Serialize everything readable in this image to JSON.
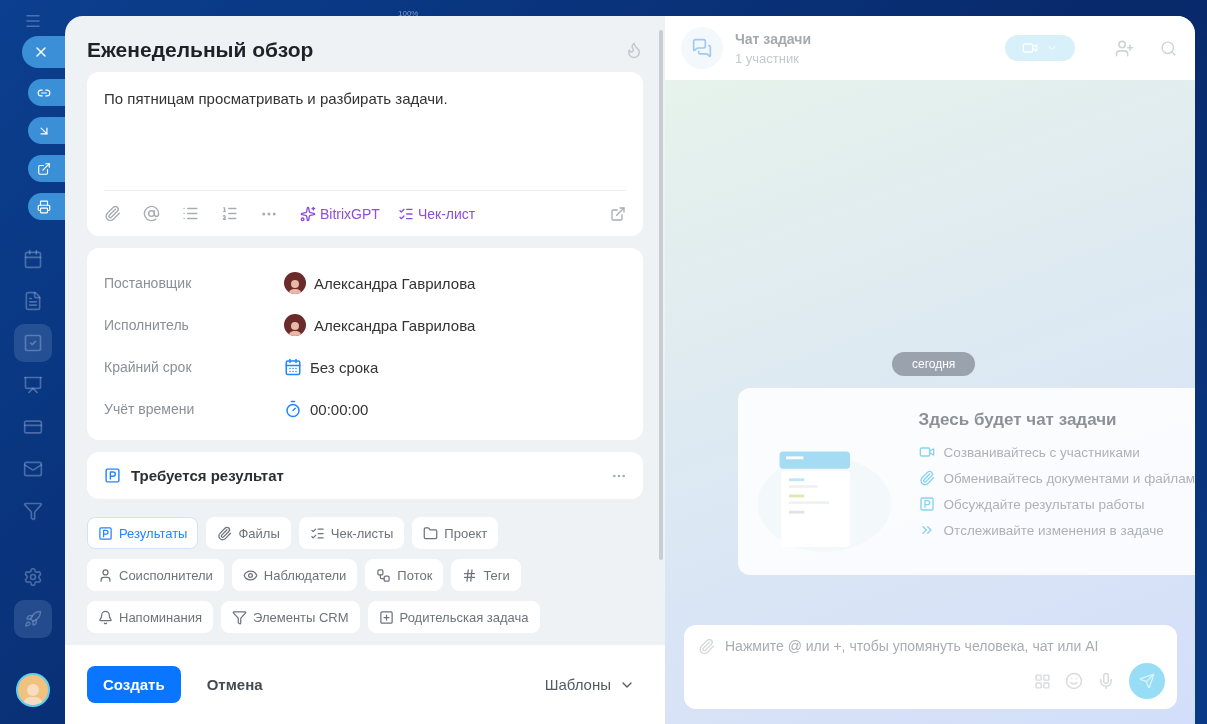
{
  "top_bar": {
    "zoom": "100%"
  },
  "sidebar": {
    "items": [
      {
        "selected": false
      },
      {
        "selected": false
      },
      {
        "selected": true
      },
      {
        "selected": false
      },
      {
        "selected": false
      },
      {
        "selected": false
      },
      {
        "selected": false
      }
    ]
  },
  "task": {
    "title": "Еженедельный обзор",
    "description": "По пятницам просматривать и разбирать задачи.",
    "editor_tools": [
      {
        "label": "BitrixGPT",
        "kind": "ai"
      },
      {
        "label": "Чек-лист",
        "kind": "checklist"
      }
    ]
  },
  "fields": [
    {
      "label": "Постановщик",
      "value": "Александра Гаврилова",
      "kind": "person"
    },
    {
      "label": "Исполнитель",
      "value": "Александра Гаврилова",
      "kind": "person"
    },
    {
      "label": "Крайний срок",
      "value": "Без срока",
      "kind": "deadline"
    },
    {
      "label": "Учёт времени",
      "value": "00:00:00",
      "kind": "timer"
    }
  ],
  "result_block": {
    "label": "Требуется результат"
  },
  "chips": [
    {
      "label": "Результаты",
      "kind": "result",
      "selected": true
    },
    {
      "label": "Файлы",
      "kind": "files",
      "selected": false
    },
    {
      "label": "Чек-листы",
      "kind": "checklist",
      "selected": false
    },
    {
      "label": "Проект",
      "kind": "project",
      "selected": false
    },
    {
      "label": "Соисполнители",
      "kind": "person",
      "selected": false
    },
    {
      "label": "Наблюдатели",
      "kind": "eye",
      "selected": false
    },
    {
      "label": "Поток",
      "kind": "flow",
      "selected": false
    },
    {
      "label": "Теги",
      "kind": "tag",
      "selected": false
    },
    {
      "label": "Напоминания",
      "kind": "bell",
      "selected": false
    },
    {
      "label": "Элементы CRM",
      "kind": "crm",
      "selected": false
    },
    {
      "label": "Родительская задача",
      "kind": "parent",
      "selected": false
    }
  ],
  "footer": {
    "create": "Создать",
    "cancel": "Отмена",
    "templates": "Шаблоны"
  },
  "chat": {
    "title": "Чат задачи",
    "subtitle": "1 участник",
    "date": "сегодня",
    "empty_title": "Здесь будет чат задачи",
    "features": [
      {
        "text": "Созванивайтесь с участниками",
        "kind": "video"
      },
      {
        "text": "Обменивайтесь документами и файлам",
        "kind": "files"
      },
      {
        "text": "Обсуждайте результаты работы",
        "kind": "result"
      },
      {
        "text": "Отслеживайте изменения в задаче",
        "kind": "track"
      }
    ],
    "input_placeholder": "Нажмите @ или +, чтобы упомянуть человека, чат или AI"
  }
}
